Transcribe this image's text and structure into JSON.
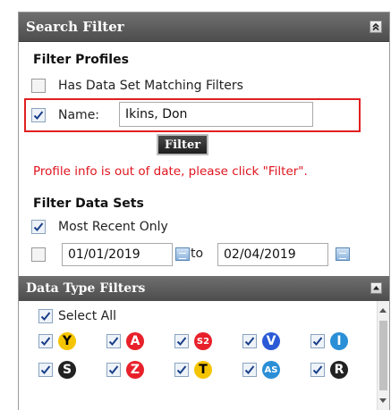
{
  "panel": {
    "title": "Search Filter"
  },
  "filter_profiles": {
    "title": "Filter Profiles",
    "has_data_set_label": "Has Data Set Matching Filters",
    "name_label": "Name:",
    "name_value": "Ikins, Don",
    "filter_button": "Filter",
    "warning": "Profile info is out of date, please click \"Filter\"."
  },
  "filter_data_sets": {
    "title": "Filter Data Sets",
    "most_recent_label": "Most Recent Only",
    "date_from": "01/01/2019",
    "to_label": "to",
    "date_to": "02/04/2019"
  },
  "data_type_filters": {
    "title": "Data Type Filters",
    "select_all_label": "Select All",
    "lines": [
      {
        "label": "Y",
        "color": "#f5c400",
        "text_color": "#000000"
      },
      {
        "label": "A",
        "color": "#e8202a",
        "text_color": "#ffffff"
      },
      {
        "label": "S2",
        "color": "#e8202a",
        "text_color": "#ffffff"
      },
      {
        "label": "V",
        "color": "#2a5ad6",
        "text_color": "#ffffff"
      },
      {
        "label": "I",
        "color": "#2a8fd6",
        "text_color": "#ffffff"
      },
      {
        "label": "S",
        "color": "#222222",
        "text_color": "#ffffff"
      },
      {
        "label": "Z",
        "color": "#e8202a",
        "text_color": "#ffffff"
      },
      {
        "label": "T",
        "color": "#f5c400",
        "text_color": "#000000"
      },
      {
        "label": "AS",
        "color": "#2a8fd6",
        "text_color": "#ffffff"
      },
      {
        "label": "R",
        "color": "#222222",
        "text_color": "#ffffff"
      }
    ]
  }
}
